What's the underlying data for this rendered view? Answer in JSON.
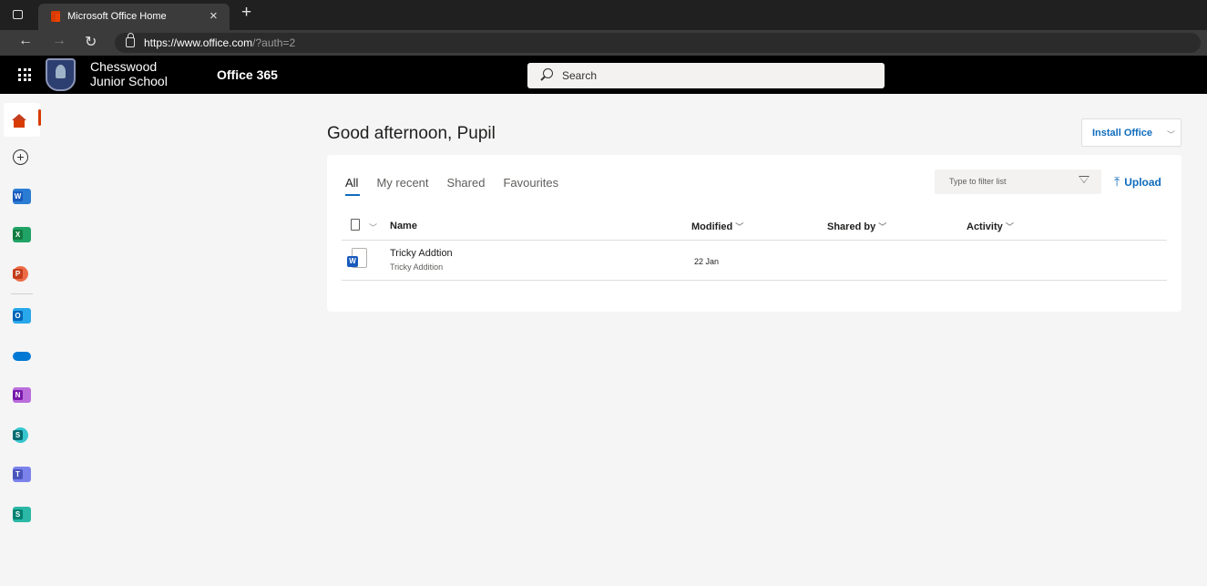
{
  "browser": {
    "tab_title": "Microsoft Office Home",
    "tab_close": "×",
    "new_tab": "+",
    "url_main": "https://www.office.com",
    "url_rest": "/?auth=2",
    "nav": {
      "back": "←",
      "forward": "→",
      "refresh": "↻"
    }
  },
  "header": {
    "school_line1": "Chesswood",
    "school_line2": "Junior School",
    "product": "Office 365",
    "search_placeholder": "Search"
  },
  "rail": {
    "items": [
      {
        "name": "home",
        "icon": "home-icon"
      },
      {
        "name": "create",
        "icon": "plus-icon",
        "glyph": "+"
      },
      {
        "name": "word",
        "icon": "word-icon",
        "letter": "W",
        "color": "#185abd",
        "accent": "#2b7cd3"
      },
      {
        "name": "excel",
        "icon": "excel-icon",
        "letter": "X",
        "color": "#107c41",
        "accent": "#21a366"
      },
      {
        "name": "powerpoint",
        "icon": "powerpoint-icon",
        "letter": "P",
        "color": "#c43e1c",
        "accent": "#ed6c47"
      },
      {
        "name": "outlook",
        "icon": "outlook-icon",
        "letter": "O",
        "color": "#0364b8",
        "accent": "#28a8ea"
      },
      {
        "name": "onedrive",
        "icon": "onedrive-icon",
        "color": "#0078d4"
      },
      {
        "name": "onenote",
        "icon": "onenote-icon",
        "letter": "N",
        "color": "#7719aa",
        "accent": "#ba6edc"
      },
      {
        "name": "sharepoint",
        "icon": "sharepoint-icon",
        "letter": "S",
        "color": "#036c70",
        "accent": "#37c6d0"
      },
      {
        "name": "teams",
        "icon": "teams-icon",
        "letter": "T",
        "color": "#4b53bc",
        "accent": "#7b83eb"
      },
      {
        "name": "sway",
        "icon": "sway-icon",
        "letter": "S",
        "color": "#008272",
        "accent": "#2bb8a6"
      }
    ]
  },
  "main": {
    "greeting": "Good afternoon, Pupil",
    "install_label": "Install Office",
    "tabs": [
      "All",
      "My recent",
      "Shared",
      "Favourites"
    ],
    "filter_placeholder": "Type to filter list",
    "upload_label": "Upload",
    "columns": {
      "name": "Name",
      "modified": "Modified",
      "shared_by": "Shared by",
      "activity": "Activity"
    },
    "files": [
      {
        "name": "Tricky Addtion",
        "location": "Tricky Addition",
        "modified": "22 Jan",
        "type": "word"
      }
    ]
  }
}
